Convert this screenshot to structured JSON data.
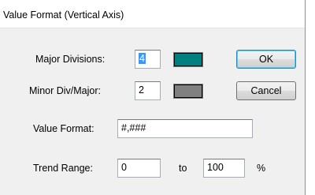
{
  "dialog": {
    "title": "Value Format (Vertical Axis)"
  },
  "fields": {
    "major_divisions": {
      "label": "Major Divisions:",
      "value": "4",
      "swatch_color": "#008080"
    },
    "minor_div_major": {
      "label": "Minor Div/Major:",
      "value": "2",
      "swatch_color": "#808080"
    },
    "value_format": {
      "label": "Value Format:",
      "value": "#,###"
    },
    "trend_range": {
      "label": "Trend Range:",
      "from": "0",
      "to_label": "to",
      "to": "100",
      "unit": "%"
    }
  },
  "buttons": {
    "ok": "OK",
    "cancel": "Cancel"
  }
}
